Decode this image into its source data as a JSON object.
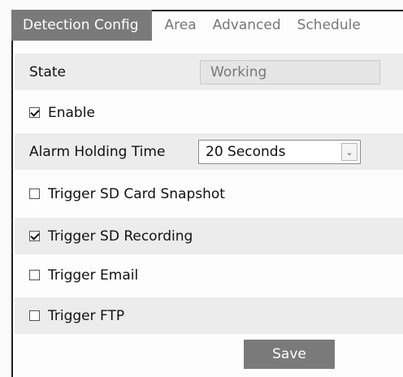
{
  "tabs": [
    {
      "label": "Detection Config",
      "active": true
    },
    {
      "label": "Area",
      "active": false
    },
    {
      "label": "Advanced",
      "active": false
    },
    {
      "label": "Schedule",
      "active": false
    }
  ],
  "state": {
    "label": "State",
    "value": "Working"
  },
  "enable": {
    "label": "Enable",
    "checked": true
  },
  "alarm_holding_time": {
    "label": "Alarm Holding Time",
    "selected": "20 Seconds"
  },
  "triggers": [
    {
      "label": "Trigger SD Card Snapshot",
      "checked": false
    },
    {
      "label": "Trigger SD Recording",
      "checked": true
    },
    {
      "label": "Trigger Email",
      "checked": false
    },
    {
      "label": "Trigger FTP",
      "checked": false
    }
  ],
  "save_label": "Save",
  "colors": {
    "tab_active_bg": "#7a7a7a",
    "row_shade": "#ececec",
    "button_bg": "#7a7a7a"
  }
}
